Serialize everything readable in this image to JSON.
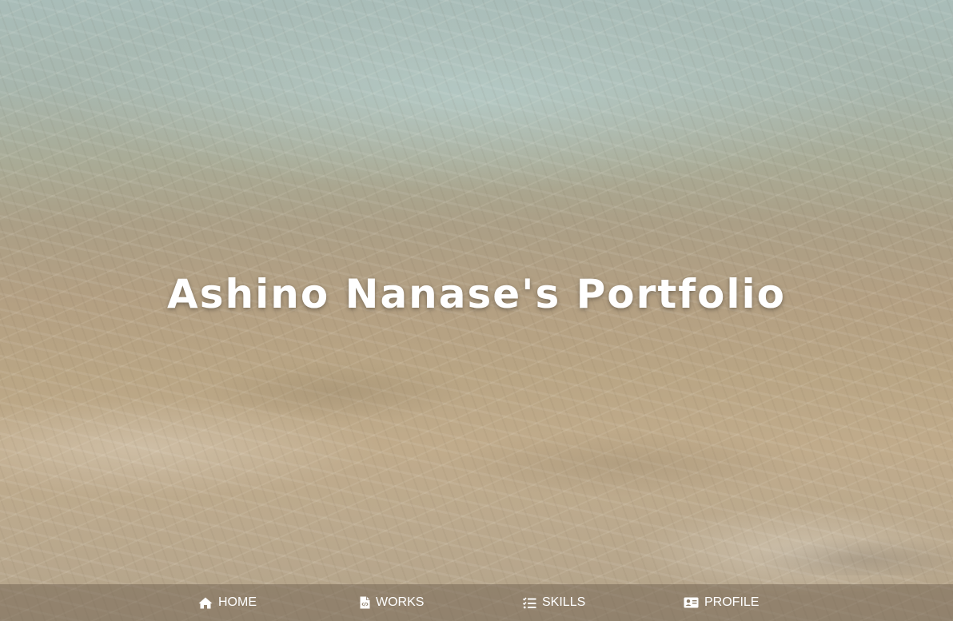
{
  "hero": {
    "title": "Ashino Nanase's Portfolio"
  },
  "nav": {
    "items": [
      {
        "label": "HOME",
        "icon": "home-icon"
      },
      {
        "label": "WORKS",
        "icon": "file-code-icon"
      },
      {
        "label": "SKILLS",
        "icon": "tasks-icon"
      },
      {
        "label": "PROFILE",
        "icon": "id-card-icon"
      }
    ]
  },
  "colors": {
    "text": "#ffffff",
    "nav_background": "rgba(95,80,65,0.40)"
  }
}
